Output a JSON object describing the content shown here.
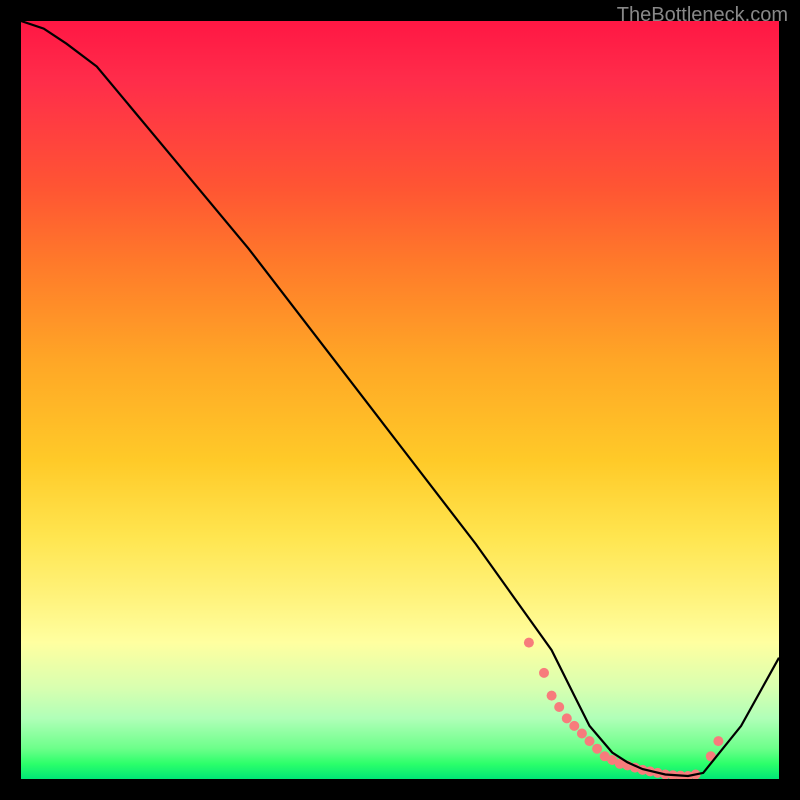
{
  "watermark": "TheBottleneck.com",
  "chart_data": {
    "type": "line",
    "title": "",
    "xlabel": "",
    "ylabel": "",
    "xlim": [
      0,
      100
    ],
    "ylim": [
      0,
      100
    ],
    "series": [
      {
        "name": "bottleneck-curve",
        "x": [
          0,
          3,
          6,
          10,
          15,
          20,
          30,
          40,
          50,
          60,
          65,
          70,
          73,
          75,
          78,
          80,
          82,
          85,
          88,
          90,
          95,
          100
        ],
        "y": [
          100,
          99,
          97,
          94,
          88,
          82,
          70,
          57,
          44,
          31,
          24,
          17,
          11,
          7,
          3.5,
          2.2,
          1.3,
          0.6,
          0.4,
          0.8,
          7,
          16
        ],
        "color": "#000000"
      }
    ],
    "markers": [
      {
        "name": "dotted-region",
        "x": [
          67,
          69,
          70,
          71,
          72,
          73,
          74,
          75,
          76,
          77,
          78,
          79,
          80,
          81,
          82,
          83,
          84,
          85,
          86,
          87,
          88,
          89,
          91,
          92
        ],
        "y": [
          18,
          14,
          11,
          9.5,
          8,
          7,
          6,
          5,
          4,
          3,
          2.5,
          2,
          1.8,
          1.5,
          1.2,
          1.0,
          0.8,
          0.6,
          0.5,
          0.45,
          0.4,
          0.6,
          3,
          5
        ],
        "color": "#f77c7c",
        "radius": 5
      }
    ],
    "gradient_stops": [
      {
        "pos": 0,
        "color": "#ff1744"
      },
      {
        "pos": 22,
        "color": "#ff5533"
      },
      {
        "pos": 45,
        "color": "#ffa726"
      },
      {
        "pos": 68,
        "color": "#ffe54f"
      },
      {
        "pos": 88,
        "color": "#d8ffb0"
      },
      {
        "pos": 100,
        "color": "#00e676"
      }
    ]
  }
}
